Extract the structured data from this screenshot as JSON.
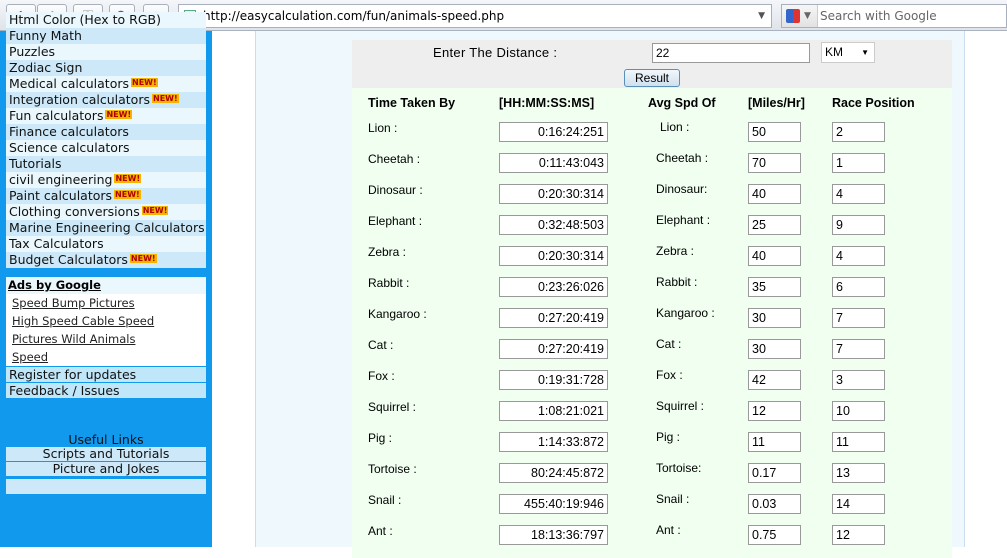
{
  "browser": {
    "url": "http://easycalculation.com/fun/animals-speed.php",
    "search_placeholder": "Search with Google"
  },
  "sidebar": {
    "items": [
      {
        "label": "Html Color (Hex to RGB)",
        "new": false
      },
      {
        "label": "Funny Math",
        "new": false
      },
      {
        "label": "Puzzles",
        "new": false
      },
      {
        "label": "Zodiac Sign",
        "new": false
      },
      {
        "label": "Medical calculators",
        "new": true
      },
      {
        "label": "Integration calculators",
        "new": true
      },
      {
        "label": "Fun calculators",
        "new": true
      },
      {
        "label": "Finance calculators",
        "new": false
      },
      {
        "label": "Science calculators",
        "new": false
      },
      {
        "label": "Tutorials",
        "new": false
      },
      {
        "label": "civil engineering",
        "new": true
      },
      {
        "label": "Paint calculators",
        "new": true
      },
      {
        "label": "Clothing conversions",
        "new": true
      },
      {
        "label": "Marine Engineering Calculators",
        "new": false
      },
      {
        "label": "Tax Calculators",
        "new": false
      },
      {
        "label": "Budget Calculators",
        "new": true
      }
    ],
    "new_badge": "NEW!",
    "ads_heading": "Ads by Google",
    "ads": [
      "Speed Bump Pictures",
      "High Speed Cable Speed",
      "Pictures Wild Animals",
      "Speed"
    ],
    "register": "Register for updates",
    "feedback": "Feedback / Issues",
    "useful_links": "Useful Links",
    "links": [
      "Scripts and Tutorials",
      "Picture and Jokes"
    ]
  },
  "form": {
    "distance_label": "Enter The Distance :",
    "distance_value": "22",
    "unit": "KM",
    "result_button": "Result"
  },
  "table": {
    "headers": [
      "Time Taken By",
      "[HH:MM:SS:MS]",
      "Avg Spd Of",
      "[Miles/Hr]",
      "Race Position"
    ],
    "rows": [
      {
        "animal": "Lion :",
        "time": "0:16:24:251",
        "animal2": "Lion :",
        "speed": "50",
        "pos": "2"
      },
      {
        "animal": "Cheetah :",
        "time": "0:11:43:043",
        "animal2": "Cheetah :",
        "speed": "70",
        "pos": "1"
      },
      {
        "animal": "Dinosaur :",
        "time": "0:20:30:314",
        "animal2": "Dinosaur:",
        "speed": "40",
        "pos": "4"
      },
      {
        "animal": "Elephant :",
        "time": "0:32:48:503",
        "animal2": "Elephant :",
        "speed": "25",
        "pos": "9"
      },
      {
        "animal": "Zebra :",
        "time": "0:20:30:314",
        "animal2": "Zebra :",
        "speed": "40",
        "pos": "4"
      },
      {
        "animal": "Rabbit :",
        "time": "0:23:26:026",
        "animal2": "Rabbit :",
        "speed": "35",
        "pos": "6"
      },
      {
        "animal": "Kangaroo :",
        "time": "0:27:20:419",
        "animal2": "Kangaroo :",
        "speed": "30",
        "pos": "7"
      },
      {
        "animal": "Cat :",
        "time": "0:27:20:419",
        "animal2": "Cat :",
        "speed": "30",
        "pos": "7"
      },
      {
        "animal": "Fox :",
        "time": "0:19:31:728",
        "animal2": "Fox :",
        "speed": "42",
        "pos": "3"
      },
      {
        "animal": "Squirrel :",
        "time": "1:08:21:021",
        "animal2": "Squirrel :",
        "speed": "12",
        "pos": "10"
      },
      {
        "animal": "Pig :",
        "time": "1:14:33:872",
        "animal2": "Pig :",
        "speed": "11",
        "pos": "11"
      },
      {
        "animal": "Tortoise :",
        "time": "80:24:45:872",
        "animal2": "Tortoise:",
        "speed": "0.17",
        "pos": "13"
      },
      {
        "animal": "Snail :",
        "time": "455:40:19:946",
        "animal2": "Snail :",
        "speed": "0.03",
        "pos": "14"
      },
      {
        "animal": "Ant :",
        "time": "18:13:36:797",
        "animal2": "Ant :",
        "speed": "0.75",
        "pos": "12"
      }
    ]
  }
}
